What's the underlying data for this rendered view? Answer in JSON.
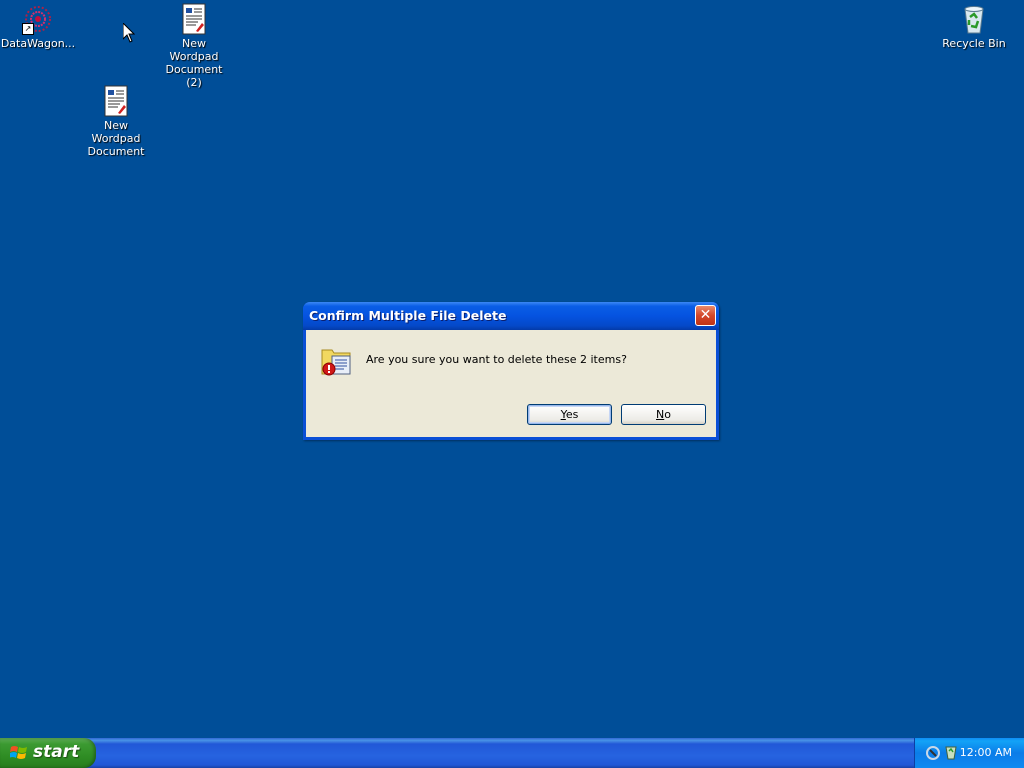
{
  "desktop": {
    "icons": [
      {
        "label": "DataWagon..."
      },
      {
        "label": "New Wordpad Document (2)"
      },
      {
        "label": "New Wordpad Document"
      },
      {
        "label": "Recycle Bin"
      }
    ],
    "background_color": "#004e98"
  },
  "dialog": {
    "title": "Confirm Multiple File Delete",
    "message": "Are you sure you want to delete these 2 items?",
    "yes_label": "Yes",
    "no_label": "No",
    "icon": "delete-warning-icon"
  },
  "taskbar": {
    "start_label": "start",
    "clock": "12:00 AM",
    "tray_icons": [
      "network-icon",
      "security-shield-icon"
    ]
  }
}
